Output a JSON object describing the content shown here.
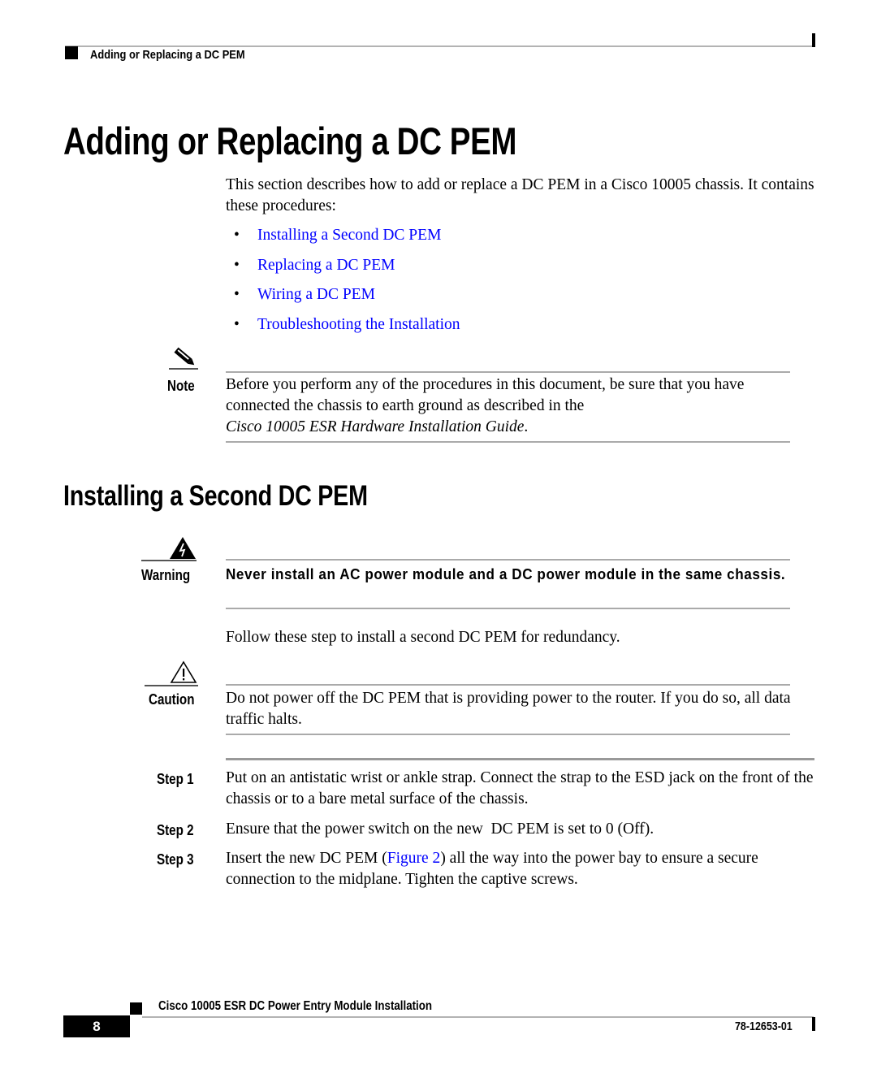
{
  "header": {
    "running_title": "Adding or Replacing a DC PEM"
  },
  "main": {
    "title": "Adding or Replacing a DC PEM",
    "intro": "This section describes how to add or replace a DC PEM in a Cisco 10005 chassis. It contains these procedures:",
    "procedures": [
      {
        "bullet": "•",
        "label": "Installing a Second DC PEM"
      },
      {
        "bullet": "•",
        "label": "Replacing a DC PEM"
      },
      {
        "bullet": "•",
        "label": "Wiring a DC PEM"
      },
      {
        "bullet": "•",
        "label": "Troubleshooting the Installation"
      }
    ],
    "note": {
      "icon": "pencil-icon",
      "label": "Note",
      "text": "Before you perform any of the procedures in this document, be sure that you have connected the chassis to earth ground as described in the",
      "citation": "Cisco 10005 ESR Hardware Installation Guide",
      "citation_end": "."
    }
  },
  "section": {
    "title": "Installing a Second DC PEM",
    "warning": {
      "icon": "electrical-hazard-icon",
      "label": "Warning",
      "text": "Never install an AC power module and a DC power module in the same chassis."
    },
    "lead": "Follow these step to install a second DC PEM for redundancy.",
    "caution": {
      "icon": "caution-triangle-icon",
      "label": "Caution",
      "text": "Do not power off the DC PEM that is providing power to the router. If you do so, all data traffic halts."
    },
    "steps": [
      {
        "label": "Step 1",
        "text": "Put on an antistatic wrist or ankle strap. Connect the strap to the ESD jack on the front of the chassis or to a bare metal surface of the chassis."
      },
      {
        "label": "Step 2",
        "text": "Ensure that the power switch on the new  DC PEM is set to 0 (Off)."
      },
      {
        "label": "Step 3",
        "text_before": "Insert the new DC PEM (",
        "link": "Figure 2",
        "text_after": ") all the way into the power bay to ensure a secure connection to the midplane. Tighten the captive screws."
      }
    ]
  },
  "footer": {
    "book_title": "Cisco 10005 ESR DC Power Entry Module Installation",
    "page_number": "8",
    "doc_number": "78-12653-01"
  },
  "colors": {
    "link": "#0000ff",
    "rule": "#aaaaaa"
  }
}
